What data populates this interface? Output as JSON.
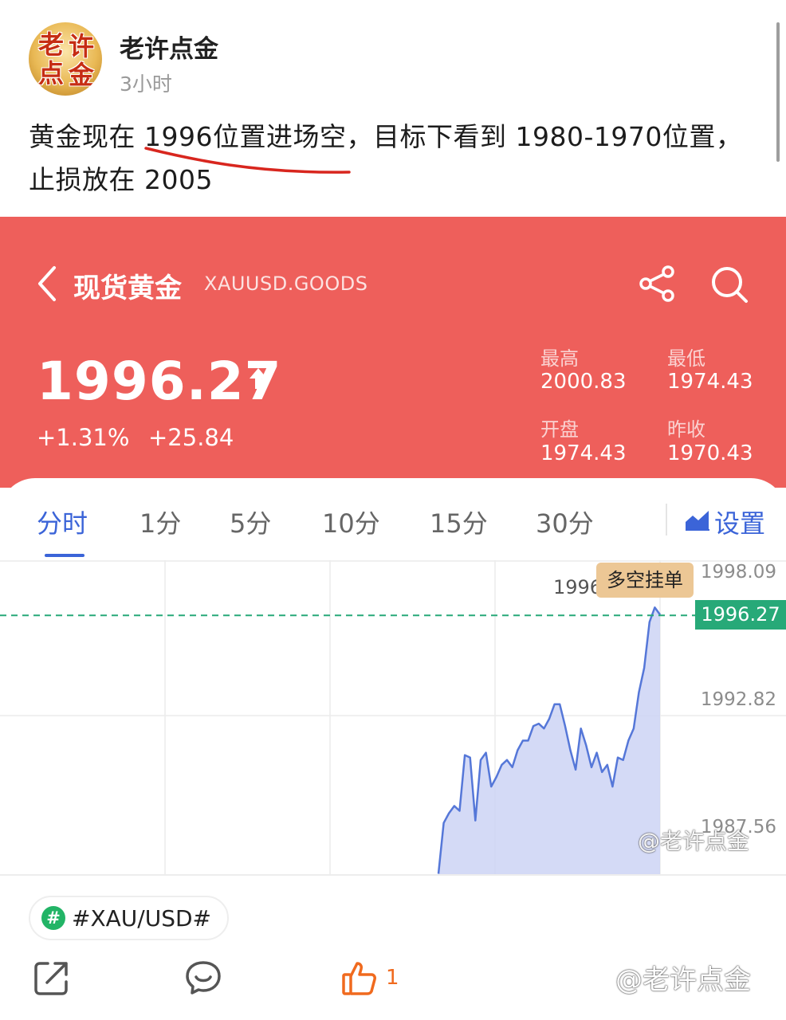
{
  "post": {
    "author": "老许点金",
    "time": "3小时",
    "avatar_chars": [
      "老",
      "许",
      "点",
      "金"
    ],
    "text_line1": "黄金现在 1996位置进场空，目标下看到 1980-1970位置，",
    "text_line2": "止损放在 2005"
  },
  "quote": {
    "name": "现货黄金",
    "code": "XAUUSD.GOODS",
    "price": "1996.27",
    "change_pct": "+1.31%",
    "change": "+25.84",
    "stats": [
      {
        "label": "最高",
        "value": "2000.83"
      },
      {
        "label": "最低",
        "value": "1974.43"
      },
      {
        "label": "开盘",
        "value": "1974.43"
      },
      {
        "label": "昨收",
        "value": "1970.43"
      }
    ]
  },
  "tabs": [
    "分时",
    "1分",
    "5分",
    "10分",
    "15分",
    "30分"
  ],
  "active_tab": "分时",
  "settings_label": "设置",
  "chart_data": {
    "type": "area",
    "title": "",
    "y_ticks": [
      "1998.09",
      "1992.82",
      "1987.56"
    ],
    "ylim": [
      1985.55,
      1998.55
    ],
    "current_price": 1996.27,
    "current_price_label": "1996.27",
    "peak_label": "1996",
    "callout": "多空挂单",
    "line_color": "#5577d8",
    "fill_color": "#cdd4f4",
    "current_line_color": "#27a978",
    "values": [
      1985.6,
      1987.7,
      1988.1,
      1988.4,
      1988.2,
      1990.5,
      1990.4,
      1987.8,
      1990.3,
      1990.6,
      1989.2,
      1989.6,
      1990.1,
      1990.3,
      1990.0,
      1990.7,
      1991.1,
      1991.1,
      1991.7,
      1991.8,
      1991.6,
      1992.0,
      1992.6,
      1992.6,
      1991.7,
      1990.7,
      1989.9,
      1991.6,
      1990.9,
      1990.0,
      1990.6,
      1989.8,
      1990.1,
      1989.2,
      1990.4,
      1990.3,
      1991.1,
      1991.6,
      1993.1,
      1994.1,
      1996.0,
      1996.6,
      1996.3
    ]
  },
  "watermark": "@老许点金",
  "hashtag": "#XAU/USD#",
  "like_count": "1",
  "colors": {
    "card_red": "#ee5f5b",
    "accent_blue": "#3b64d8",
    "up_green": "#27a978",
    "like_orange": "#f06a1e"
  },
  "icons": [
    "back-icon",
    "share-icon",
    "search-icon",
    "up-arrow-icon",
    "settings-chart-icon",
    "hash-icon",
    "repost-icon",
    "comment-icon",
    "like-icon"
  ]
}
